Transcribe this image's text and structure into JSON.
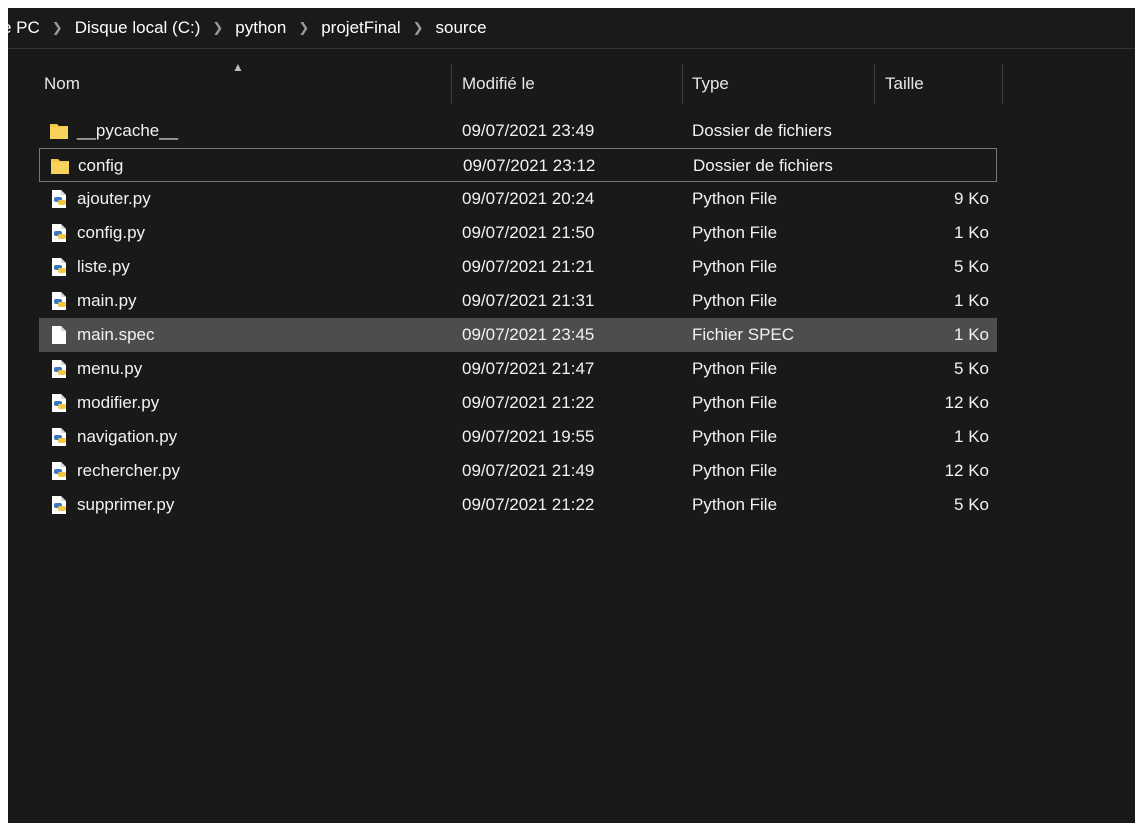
{
  "breadcrumbs": [
    "e PC",
    "Disque local (C:)",
    "python",
    "projetFinal",
    "source"
  ],
  "separator_icon": "chevron-right-icon",
  "columns": {
    "name": "Nom",
    "modified": "Modifié le",
    "type": "Type",
    "size": "Taille"
  },
  "sort_icon": "sort-ascending-icon",
  "files": [
    {
      "name": "__pycache__",
      "modified": "09/07/2021 23:49",
      "type": "Dossier de fichiers",
      "size": "",
      "icon": "folder-icon"
    },
    {
      "name": "config",
      "modified": "09/07/2021 23:12",
      "type": "Dossier de fichiers",
      "size": "",
      "icon": "folder-icon"
    },
    {
      "name": "ajouter.py",
      "modified": "09/07/2021 20:24",
      "type": "Python File",
      "size": "9 Ko",
      "icon": "python-file-icon"
    },
    {
      "name": "config.py",
      "modified": "09/07/2021 21:50",
      "type": "Python File",
      "size": "1 Ko",
      "icon": "python-file-icon"
    },
    {
      "name": "liste.py",
      "modified": "09/07/2021 21:21",
      "type": "Python File",
      "size": "5 Ko",
      "icon": "python-file-icon"
    },
    {
      "name": "main.py",
      "modified": "09/07/2021 21:31",
      "type": "Python File",
      "size": "1 Ko",
      "icon": "python-file-icon"
    },
    {
      "name": "main.spec",
      "modified": "09/07/2021 23:45",
      "type": "Fichier SPEC",
      "size": "1 Ko",
      "icon": "blank-file-icon"
    },
    {
      "name": "menu.py",
      "modified": "09/07/2021 21:47",
      "type": "Python File",
      "size": "5 Ko",
      "icon": "python-file-icon"
    },
    {
      "name": "modifier.py",
      "modified": "09/07/2021 21:22",
      "type": "Python File",
      "size": "12 Ko",
      "icon": "python-file-icon"
    },
    {
      "name": "navigation.py",
      "modified": "09/07/2021 19:55",
      "type": "Python File",
      "size": "1 Ko",
      "icon": "python-file-icon"
    },
    {
      "name": "rechercher.py",
      "modified": "09/07/2021 21:49",
      "type": "Python File",
      "size": "12 Ko",
      "icon": "python-file-icon"
    },
    {
      "name": "supprimer.py",
      "modified": "09/07/2021 21:22",
      "type": "Python File",
      "size": "5 Ko",
      "icon": "python-file-icon"
    }
  ],
  "selected_row": 6,
  "focused_row": 1,
  "colors": {
    "background": "#191919",
    "selected_row": "#4d4d4d",
    "folder": "#f2c744",
    "python_blue": "#3a78c4",
    "python_yellow": "#f2c744"
  }
}
